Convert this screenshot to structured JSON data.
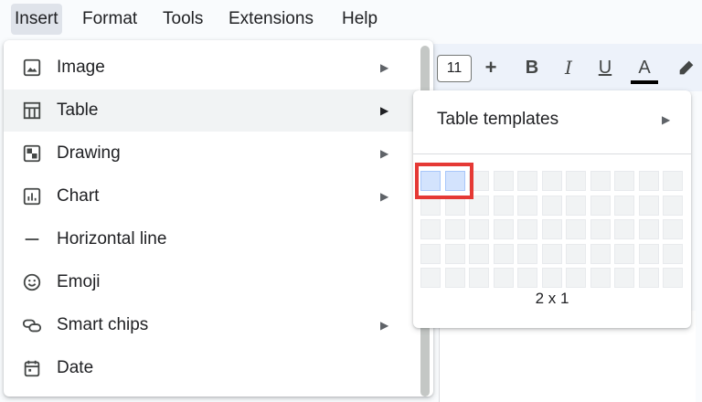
{
  "menubar": {
    "items": [
      {
        "label": "Insert",
        "active": true
      },
      {
        "label": "Format"
      },
      {
        "label": "Tools"
      },
      {
        "label": "Extensions"
      },
      {
        "label": "Help"
      }
    ]
  },
  "toolbar": {
    "font_size": "11",
    "plus": "+",
    "bold": "B",
    "italic": "I",
    "underline": "U",
    "text_color": "A",
    "highlight_icon": "highlighter-icon"
  },
  "insert_menu": {
    "items": [
      {
        "label": "Image",
        "icon": "image-icon",
        "submenu": true
      },
      {
        "label": "Table",
        "icon": "table-icon",
        "submenu": true,
        "active": true
      },
      {
        "label": "Drawing",
        "icon": "drawing-icon",
        "submenu": true
      },
      {
        "label": "Chart",
        "icon": "chart-icon",
        "submenu": true
      },
      {
        "label": "Horizontal line",
        "icon": "horizontal-line-icon",
        "submenu": false
      },
      {
        "label": "Emoji",
        "icon": "emoji-icon",
        "submenu": false
      },
      {
        "label": "Smart chips",
        "icon": "smart-chips-icon",
        "submenu": true
      },
      {
        "label": "Date",
        "icon": "date-icon",
        "submenu": false
      }
    ]
  },
  "table_submenu": {
    "templates_label": "Table templates",
    "grid": {
      "cols": 11,
      "rows": 5,
      "selected_cols": 2,
      "selected_rows": 1
    },
    "size_label": "2 x 1"
  },
  "colors": {
    "accent_highlight": "#e53935",
    "selected_cell": "#d3e3fd"
  }
}
